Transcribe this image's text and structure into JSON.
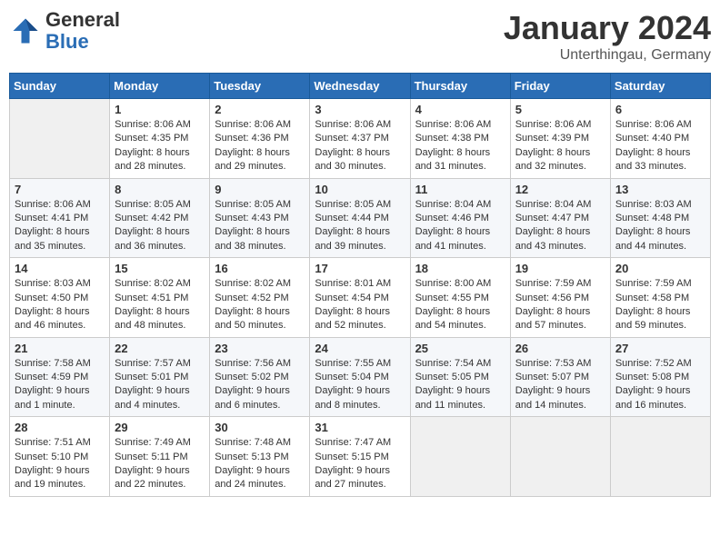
{
  "header": {
    "logo": {
      "general": "General",
      "blue": "Blue"
    },
    "title": "January 2024",
    "location": "Unterthingau, Germany"
  },
  "days_of_week": [
    "Sunday",
    "Monday",
    "Tuesday",
    "Wednesday",
    "Thursday",
    "Friday",
    "Saturday"
  ],
  "weeks": [
    [
      {
        "day": "",
        "info": ""
      },
      {
        "day": "1",
        "info": "Sunrise: 8:06 AM\nSunset: 4:35 PM\nDaylight: 8 hours\nand 28 minutes."
      },
      {
        "day": "2",
        "info": "Sunrise: 8:06 AM\nSunset: 4:36 PM\nDaylight: 8 hours\nand 29 minutes."
      },
      {
        "day": "3",
        "info": "Sunrise: 8:06 AM\nSunset: 4:37 PM\nDaylight: 8 hours\nand 30 minutes."
      },
      {
        "day": "4",
        "info": "Sunrise: 8:06 AM\nSunset: 4:38 PM\nDaylight: 8 hours\nand 31 minutes."
      },
      {
        "day": "5",
        "info": "Sunrise: 8:06 AM\nSunset: 4:39 PM\nDaylight: 8 hours\nand 32 minutes."
      },
      {
        "day": "6",
        "info": "Sunrise: 8:06 AM\nSunset: 4:40 PM\nDaylight: 8 hours\nand 33 minutes."
      }
    ],
    [
      {
        "day": "7",
        "info": "Sunrise: 8:06 AM\nSunset: 4:41 PM\nDaylight: 8 hours\nand 35 minutes."
      },
      {
        "day": "8",
        "info": "Sunrise: 8:05 AM\nSunset: 4:42 PM\nDaylight: 8 hours\nand 36 minutes."
      },
      {
        "day": "9",
        "info": "Sunrise: 8:05 AM\nSunset: 4:43 PM\nDaylight: 8 hours\nand 38 minutes."
      },
      {
        "day": "10",
        "info": "Sunrise: 8:05 AM\nSunset: 4:44 PM\nDaylight: 8 hours\nand 39 minutes."
      },
      {
        "day": "11",
        "info": "Sunrise: 8:04 AM\nSunset: 4:46 PM\nDaylight: 8 hours\nand 41 minutes."
      },
      {
        "day": "12",
        "info": "Sunrise: 8:04 AM\nSunset: 4:47 PM\nDaylight: 8 hours\nand 43 minutes."
      },
      {
        "day": "13",
        "info": "Sunrise: 8:03 AM\nSunset: 4:48 PM\nDaylight: 8 hours\nand 44 minutes."
      }
    ],
    [
      {
        "day": "14",
        "info": "Sunrise: 8:03 AM\nSunset: 4:50 PM\nDaylight: 8 hours\nand 46 minutes."
      },
      {
        "day": "15",
        "info": "Sunrise: 8:02 AM\nSunset: 4:51 PM\nDaylight: 8 hours\nand 48 minutes."
      },
      {
        "day": "16",
        "info": "Sunrise: 8:02 AM\nSunset: 4:52 PM\nDaylight: 8 hours\nand 50 minutes."
      },
      {
        "day": "17",
        "info": "Sunrise: 8:01 AM\nSunset: 4:54 PM\nDaylight: 8 hours\nand 52 minutes."
      },
      {
        "day": "18",
        "info": "Sunrise: 8:00 AM\nSunset: 4:55 PM\nDaylight: 8 hours\nand 54 minutes."
      },
      {
        "day": "19",
        "info": "Sunrise: 7:59 AM\nSunset: 4:56 PM\nDaylight: 8 hours\nand 57 minutes."
      },
      {
        "day": "20",
        "info": "Sunrise: 7:59 AM\nSunset: 4:58 PM\nDaylight: 8 hours\nand 59 minutes."
      }
    ],
    [
      {
        "day": "21",
        "info": "Sunrise: 7:58 AM\nSunset: 4:59 PM\nDaylight: 9 hours\nand 1 minute."
      },
      {
        "day": "22",
        "info": "Sunrise: 7:57 AM\nSunset: 5:01 PM\nDaylight: 9 hours\nand 4 minutes."
      },
      {
        "day": "23",
        "info": "Sunrise: 7:56 AM\nSunset: 5:02 PM\nDaylight: 9 hours\nand 6 minutes."
      },
      {
        "day": "24",
        "info": "Sunrise: 7:55 AM\nSunset: 5:04 PM\nDaylight: 9 hours\nand 8 minutes."
      },
      {
        "day": "25",
        "info": "Sunrise: 7:54 AM\nSunset: 5:05 PM\nDaylight: 9 hours\nand 11 minutes."
      },
      {
        "day": "26",
        "info": "Sunrise: 7:53 AM\nSunset: 5:07 PM\nDaylight: 9 hours\nand 14 minutes."
      },
      {
        "day": "27",
        "info": "Sunrise: 7:52 AM\nSunset: 5:08 PM\nDaylight: 9 hours\nand 16 minutes."
      }
    ],
    [
      {
        "day": "28",
        "info": "Sunrise: 7:51 AM\nSunset: 5:10 PM\nDaylight: 9 hours\nand 19 minutes."
      },
      {
        "day": "29",
        "info": "Sunrise: 7:49 AM\nSunset: 5:11 PM\nDaylight: 9 hours\nand 22 minutes."
      },
      {
        "day": "30",
        "info": "Sunrise: 7:48 AM\nSunset: 5:13 PM\nDaylight: 9 hours\nand 24 minutes."
      },
      {
        "day": "31",
        "info": "Sunrise: 7:47 AM\nSunset: 5:15 PM\nDaylight: 9 hours\nand 27 minutes."
      },
      {
        "day": "",
        "info": ""
      },
      {
        "day": "",
        "info": ""
      },
      {
        "day": "",
        "info": ""
      }
    ]
  ]
}
